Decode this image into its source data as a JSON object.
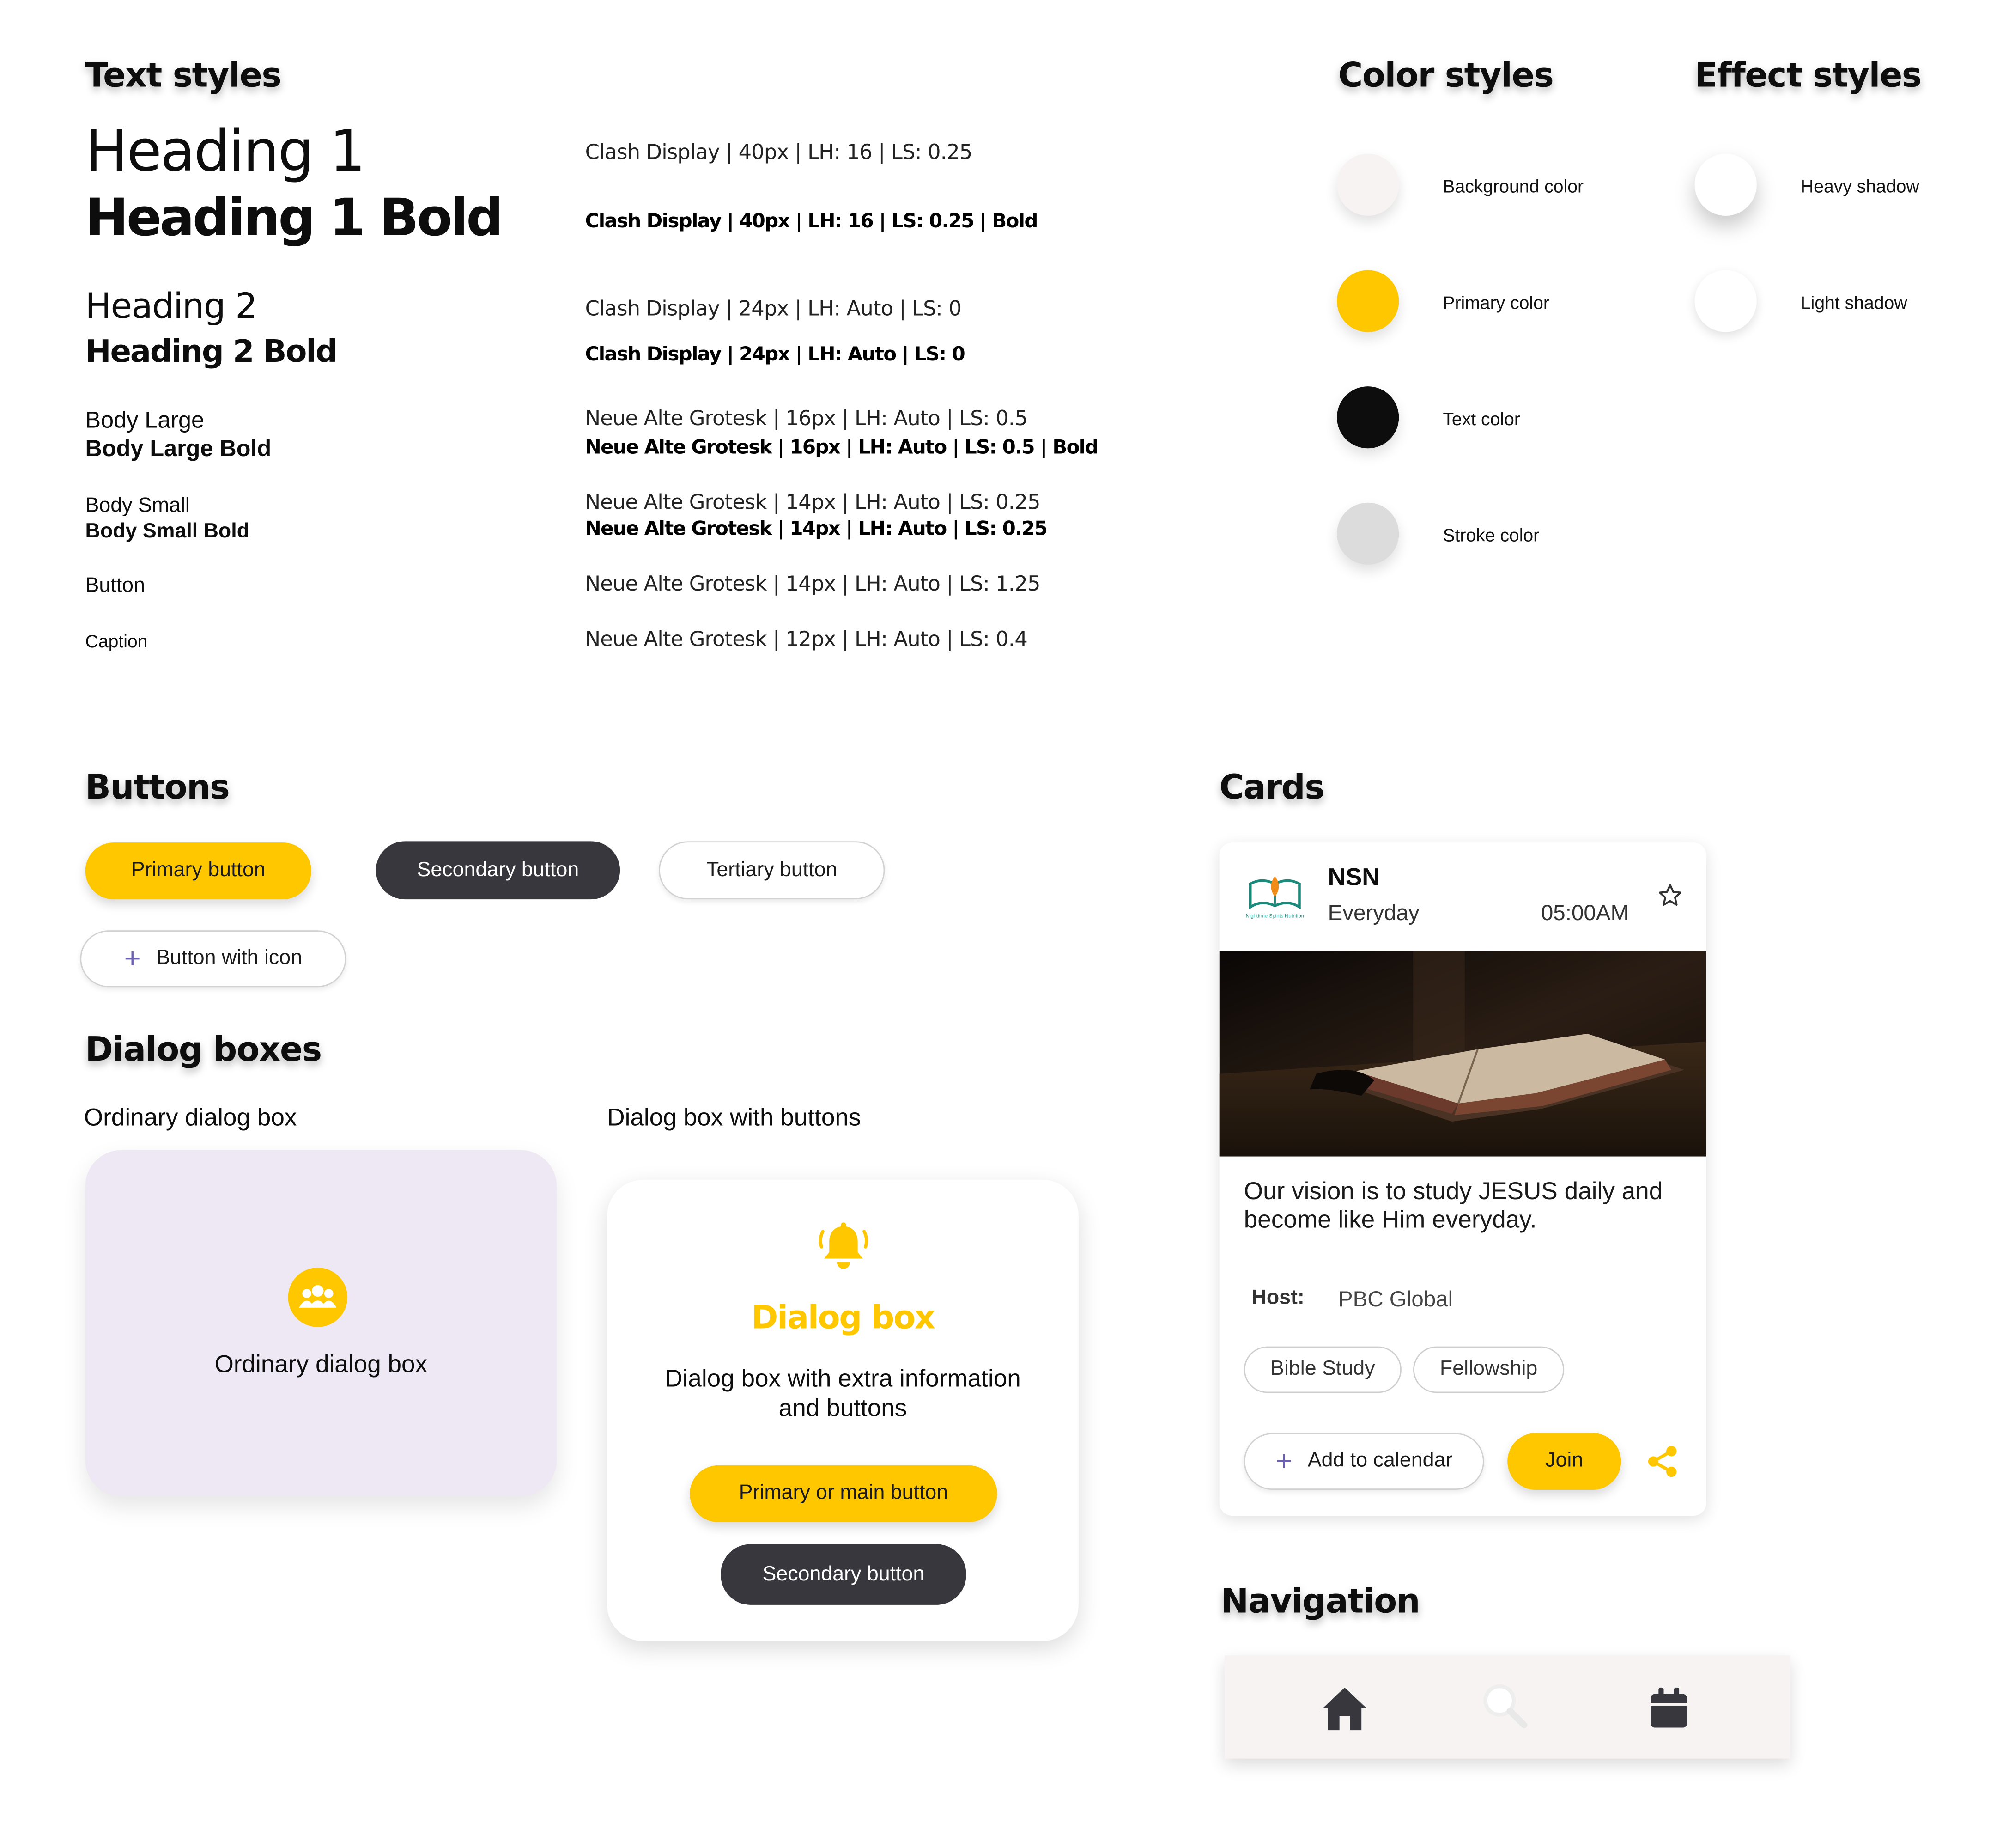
{
  "text_styles": {
    "title": "Text styles",
    "rows": [
      {
        "label": "Heading 1",
        "spec": "Clash Display | 40px | LH: 16 | LS: 0.25"
      },
      {
        "label": "Heading 1 Bold",
        "spec": "Clash Display | 40px | LH: 16 | LS: 0.25 | Bold"
      },
      {
        "label": "Heading 2",
        "spec": "Clash Display | 24px | LH: Auto | LS: 0"
      },
      {
        "label": "Heading 2 Bold",
        "spec": "Clash Display | 24px | LH: Auto | LS: 0"
      },
      {
        "label": "Body Large",
        "spec": "Neue Alte Grotesk | 16px | LH: Auto | LS: 0.5"
      },
      {
        "label": "Body Large Bold",
        "spec": "Neue Alte Grotesk | 16px | LH: Auto | LS: 0.5 | Bold"
      },
      {
        "label": "Body Small",
        "spec": "Neue Alte Grotesk | 14px | LH: Auto | LS: 0.25"
      },
      {
        "label": "Body Small Bold",
        "spec": "Neue Alte Grotesk | 14px | LH: Auto | LS: 0.25"
      },
      {
        "label": "Button",
        "spec": "Neue Alte Grotesk | 14px | LH: Auto | LS: 1.25"
      },
      {
        "label": "Caption",
        "spec": "Neue Alte Grotesk | 12px | LH: Auto | LS: 0.4"
      }
    ]
  },
  "color_styles": {
    "title": "Color styles",
    "items": [
      {
        "label": "Background color",
        "color": "#f6f3f2"
      },
      {
        "label": "Primary color",
        "color": "#ffc700"
      },
      {
        "label": "Text color",
        "color": "#0d0d0d"
      },
      {
        "label": "Stroke color",
        "color": "#dcdcdc"
      }
    ]
  },
  "effect_styles": {
    "title": "Effect styles",
    "items": [
      {
        "label": "Heavy shadow"
      },
      {
        "label": "Light shadow"
      }
    ]
  },
  "buttons": {
    "title": "Buttons",
    "primary": "Primary button",
    "secondary": "Secondary button",
    "tertiary": "Tertiary button",
    "with_icon": "Button with icon"
  },
  "dialogs": {
    "title": "Dialog boxes",
    "ordinary_caption": "Ordinary dialog box",
    "ordinary_text": "Ordinary dialog box",
    "buttons_caption": "Dialog box with buttons",
    "box_title": "Dialog box",
    "box_text": "Dialog box with extra information and buttons",
    "primary": "Primary or main button",
    "secondary": "Secondary button"
  },
  "cards": {
    "title": "Cards",
    "org": "NSN",
    "logo_text": "Nighttime Spirits Nutrition",
    "frequency": "Everyday",
    "time": "05:00AM",
    "description": "Our vision is to study JESUS daily and become like Him everyday.",
    "host_label": "Host:",
    "host_value": "PBC Global",
    "tags": [
      "Bible Study",
      "Fellowship"
    ],
    "add_calendar": "Add to calendar",
    "join": "Join"
  },
  "navigation": {
    "title": "Navigation",
    "items": [
      "home-icon",
      "search-icon",
      "calendar-icon"
    ]
  },
  "colors": {
    "primary": "#ffc700",
    "dark": "#37373d",
    "dialog_bg": "#ede8f3",
    "nav_bg": "#f6f3f2"
  }
}
